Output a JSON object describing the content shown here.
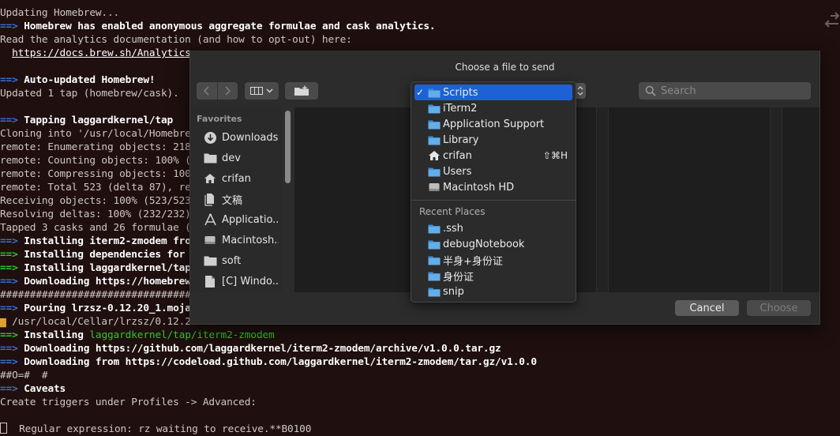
{
  "terminal": {
    "lines": [
      {
        "a": "",
        "t": "Updating Homebrew..."
      },
      {
        "a": "==>",
        "t": "Homebrew has enabled anonymous aggregate formulae and cask analytics."
      },
      {
        "a": "",
        "t": "Read the analytics documentation (and how to opt-out) here:"
      },
      {
        "a": "",
        "t": "https://docs.brew.sh/Analytics"
      },
      {
        "a": "",
        "t": ""
      },
      {
        "a": "==>",
        "t": "Auto-updated Homebrew!"
      },
      {
        "a": "",
        "t": "Updated 1 tap (homebrew/cask)."
      },
      {
        "a": "",
        "t": ""
      },
      {
        "a": "==>",
        "t": "Tapping laggardkernel/tap"
      },
      {
        "a": "",
        "t": "Cloning into '/usr/local/Homebrew/"
      },
      {
        "a": "",
        "t": "remote: Enumerating objects: 218, d"
      },
      {
        "a": "",
        "t": "remote: Counting objects: 100% (218"
      },
      {
        "a": "",
        "t": "remote: Compressing objects: 100% ("
      },
      {
        "a": "",
        "t": "remote: Total 523 (delta 87), reuse"
      },
      {
        "a": "",
        "t": "Receiving objects: 100% (523/523), "
      },
      {
        "a": "",
        "t": "Resolving deltas: 100% (232/232), d"
      },
      {
        "a": "",
        "t": "Tapped 3 casks and 26 formulae (55"
      },
      {
        "a": "==>",
        "t": "Installing iterm2-zmodem from "
      },
      {
        "a": "==>",
        "t": "Installing dependencies for la"
      },
      {
        "a": "==>",
        "t": "Installing laggardkernel/tap/i"
      },
      {
        "a": "==>",
        "t": "Downloading https://homebrew.b"
      },
      {
        "a": "",
        "t": "##################################"
      },
      {
        "a": "==>",
        "t": "Pouring lrzsz-0.12.20_1.mojave"
      },
      {
        "a": "",
        "t": "/usr/local/Cellar/lrzsz/0.12.20"
      },
      {
        "a": "==>",
        "t": "Installing "
      },
      {
        "a": "==>",
        "t": "Downloading https://github.com/laggardkernel/iterm2-zmodem/archive/v1.0.0.tar.gz"
      },
      {
        "a": "==>",
        "t": "Downloading from https://codeload.github.com/laggardkernel/iterm2-zmodem/tar.gz/v1.0.0"
      },
      {
        "a": "",
        "t": "##O=#  #"
      },
      {
        "a": "==>",
        "t": "Caveats"
      },
      {
        "a": "",
        "t": "Create triggers under Profiles -> Advanced:"
      },
      {
        "a": "",
        "t": ""
      },
      {
        "a": "",
        "t": "  Regular expression: rz waiting to receive.**B0100"
      }
    ],
    "highlight_text": "laggardkernel/tap/",
    "highlight_suffix": "iterm2-zmodem"
  },
  "dialog": {
    "title": "Choose a file to send",
    "search_placeholder": "Search",
    "cancel_label": "Cancel",
    "choose_label": "Choose",
    "favorites_header": "Favorites",
    "favorites": [
      {
        "label": "Downloads",
        "icon": "downloads-icon"
      },
      {
        "label": "dev",
        "icon": "folder-icon"
      },
      {
        "label": "crifan",
        "icon": "home-icon"
      },
      {
        "label": "文稿",
        "icon": "documents-icon"
      },
      {
        "label": "Applicatio...",
        "icon": "applications-icon"
      },
      {
        "label": "Macintosh...",
        "icon": "harddrive-icon"
      },
      {
        "label": "soft",
        "icon": "folder-icon"
      },
      {
        "label": "[C] Windo...",
        "icon": "document-icon"
      }
    ]
  },
  "dropdown": {
    "items": [
      {
        "label": "Scripts",
        "icon": "folder-icon",
        "selected": true,
        "check": "✓"
      },
      {
        "label": "iTerm2",
        "icon": "folder-icon"
      },
      {
        "label": "Application Support",
        "icon": "folder-icon"
      },
      {
        "label": "Library",
        "icon": "folder-icon"
      },
      {
        "label": "crifan",
        "icon": "home-icon",
        "shortcut": "⇧⌘H"
      },
      {
        "label": "Users",
        "icon": "folder-icon"
      },
      {
        "label": "Macintosh HD",
        "icon": "harddrive-icon"
      }
    ],
    "recent_header": "Recent Places",
    "recent": [
      {
        "label": ".ssh",
        "icon": "folder-icon"
      },
      {
        "label": "debugNotebook",
        "icon": "folder-icon"
      },
      {
        "label": "半身+身份证",
        "icon": "folder-icon"
      },
      {
        "label": "身份证",
        "icon": "folder-icon"
      },
      {
        "label": "snip",
        "icon": "folder-icon"
      }
    ]
  },
  "colors": {
    "selection": "#1e61d4",
    "folder": "#3d8fd8",
    "arrow_blue": "#3b6fd6",
    "arrow_green": "#2dc82d"
  }
}
